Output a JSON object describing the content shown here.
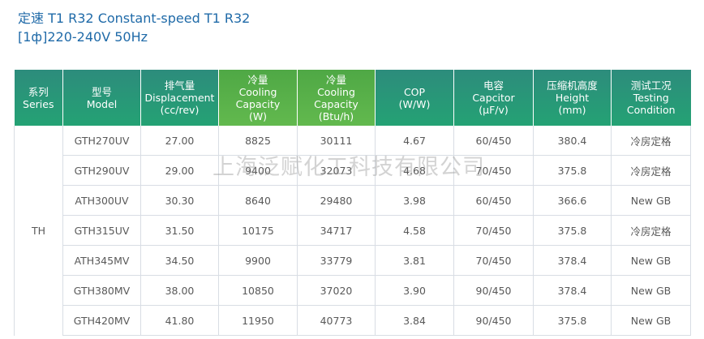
{
  "heading": {
    "line1": "定速 T1 R32 Constant-speed T1 R32",
    "line2": "[1ф]220-240V 50Hz"
  },
  "table": {
    "headers": [
      [
        "系列",
        "Series"
      ],
      [
        "型号",
        "Model"
      ],
      [
        "排气量",
        "Displacement",
        "(cc/rev)"
      ],
      [
        "冷量",
        "Cooling",
        "Capacity",
        "(W)"
      ],
      [
        "冷量",
        "Cooling",
        "Capacity",
        "(Btu/h)"
      ],
      [
        "COP",
        "(W/W)"
      ],
      [
        "电容",
        "Capcitor",
        "(μF/v)"
      ],
      [
        "压缩机高度",
        "Height",
        "(mm)"
      ],
      [
        "测试工况",
        "Testing",
        "Condition"
      ]
    ],
    "series": "TH",
    "rows": [
      [
        "GTH270UV",
        "27.00",
        "8825",
        "30111",
        "4.67",
        "60/450",
        "380.4",
        "冷房定格"
      ],
      [
        "GTH290UV",
        "29.00",
        "9400",
        "32073",
        "4.68",
        "70/450",
        "375.8",
        "冷房定格"
      ],
      [
        "ATH300UV",
        "30.30",
        "8640",
        "29480",
        "3.98",
        "60/450",
        "366.6",
        "New GB"
      ],
      [
        "GTH315UV",
        "31.50",
        "10175",
        "34717",
        "4.58",
        "70/450",
        "375.8",
        "冷房定格"
      ],
      [
        "ATH345MV",
        "34.50",
        "9900",
        "33779",
        "3.81",
        "70/450",
        "378.4",
        "New GB"
      ],
      [
        "GTH380MV",
        "38.00",
        "10850",
        "37020",
        "3.90",
        "90/450",
        "378.4",
        "New GB"
      ],
      [
        "GTH420MV",
        "41.80",
        "11950",
        "40773",
        "3.84",
        "90/450",
        "375.8",
        "New GB"
      ]
    ]
  },
  "watermark": "上海泛赋化工科技有限公司"
}
